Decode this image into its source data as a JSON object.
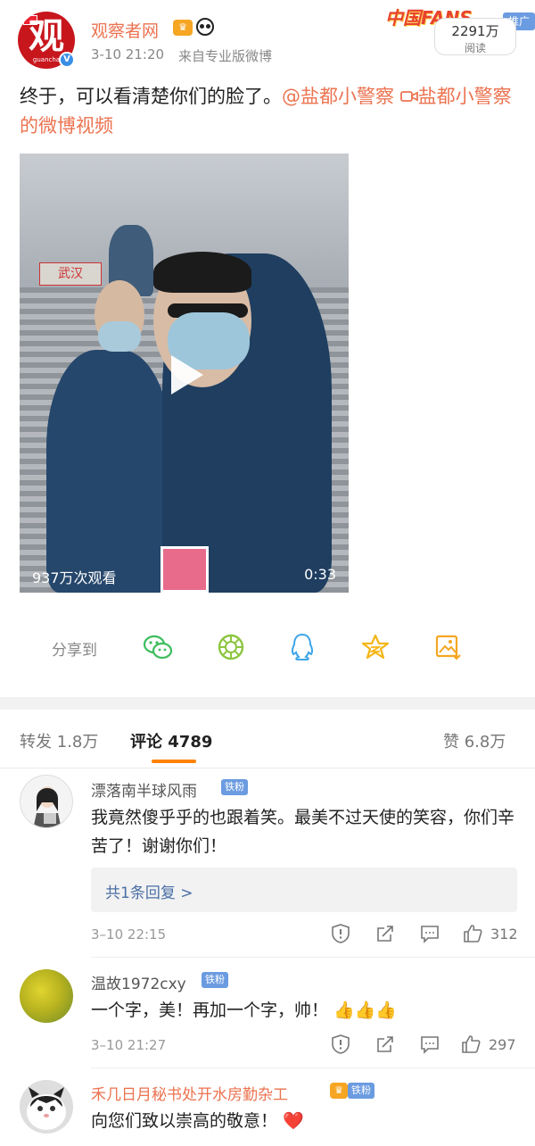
{
  "post": {
    "author": "观察者网",
    "avatar_text": "观",
    "avatar_sub": "guancha",
    "time": "3-10 21:20",
    "source": "来自专业版微博",
    "fans_banner": "中国FANS",
    "ad_tag": "推广",
    "read_count": "2291万",
    "read_label": "阅读",
    "text_main": "终于，可以看清楚你们的脸了。",
    "mention": "@盐都小警察",
    "video_link": "盐都小警察的微博视频",
    "video": {
      "views": "937万次观看",
      "duration": "0:33",
      "sign_text": "武汉"
    }
  },
  "share": {
    "label": "分享到",
    "targets": [
      "wechat-icon",
      "moments-icon",
      "qq-icon",
      "qzone-icon",
      "save-image-icon"
    ]
  },
  "tabs": {
    "repost": "转发 1.8万",
    "comments": "评论 4789",
    "likes": "赞 6.8万"
  },
  "comments": [
    {
      "name": "漂落南半球风雨",
      "badge": "铁粉",
      "text": "我竟然傻乎乎的也跟着笑。最美不过天使的笑容，你们辛苦了！谢谢你们！",
      "reply_summary": "共1条回复 >",
      "time": "3–10 22:15",
      "likes": "312"
    },
    {
      "name": "温故1972cxy",
      "badge": "铁粉",
      "text": "一个字，美！再加一个字，帅！",
      "emoji": "👍👍👍",
      "time": "3–10 21:27",
      "likes": "297"
    },
    {
      "name": "禾几日月秘书处开水房勤杂工",
      "badge": "铁粉",
      "text": "向您们致以崇高的敬意！",
      "emoji": "❤️"
    }
  ],
  "colors": {
    "accent": "#eb7350",
    "tab_underline": "#ff8200",
    "link_blue": "#4a6fa5",
    "badge_blue": "#6b9be0"
  }
}
